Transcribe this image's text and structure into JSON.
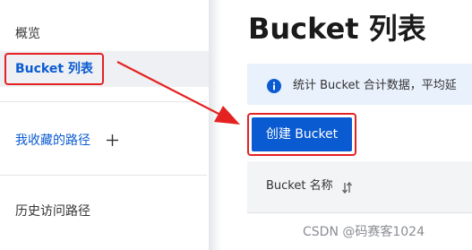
{
  "sidebar": {
    "items": [
      {
        "label": "概览"
      },
      {
        "label": "Bucket 列表"
      },
      {
        "label": "我收藏的路径"
      },
      {
        "label": "历史访问路径"
      }
    ]
  },
  "main": {
    "title": "Bucket 列表",
    "info_banner": {
      "icon": "info-icon",
      "text": "统计 Bucket 合计数据，平均延"
    },
    "create_button_label": "创建 Bucket",
    "table": {
      "columns": [
        {
          "label": "Bucket 名称",
          "sortable": true
        }
      ]
    }
  },
  "watermark": "CSDN @码赛客1024",
  "colors": {
    "accent": "#0a5bd1",
    "annotation": "#e52222",
    "banner_bg": "#e8f1fc"
  }
}
